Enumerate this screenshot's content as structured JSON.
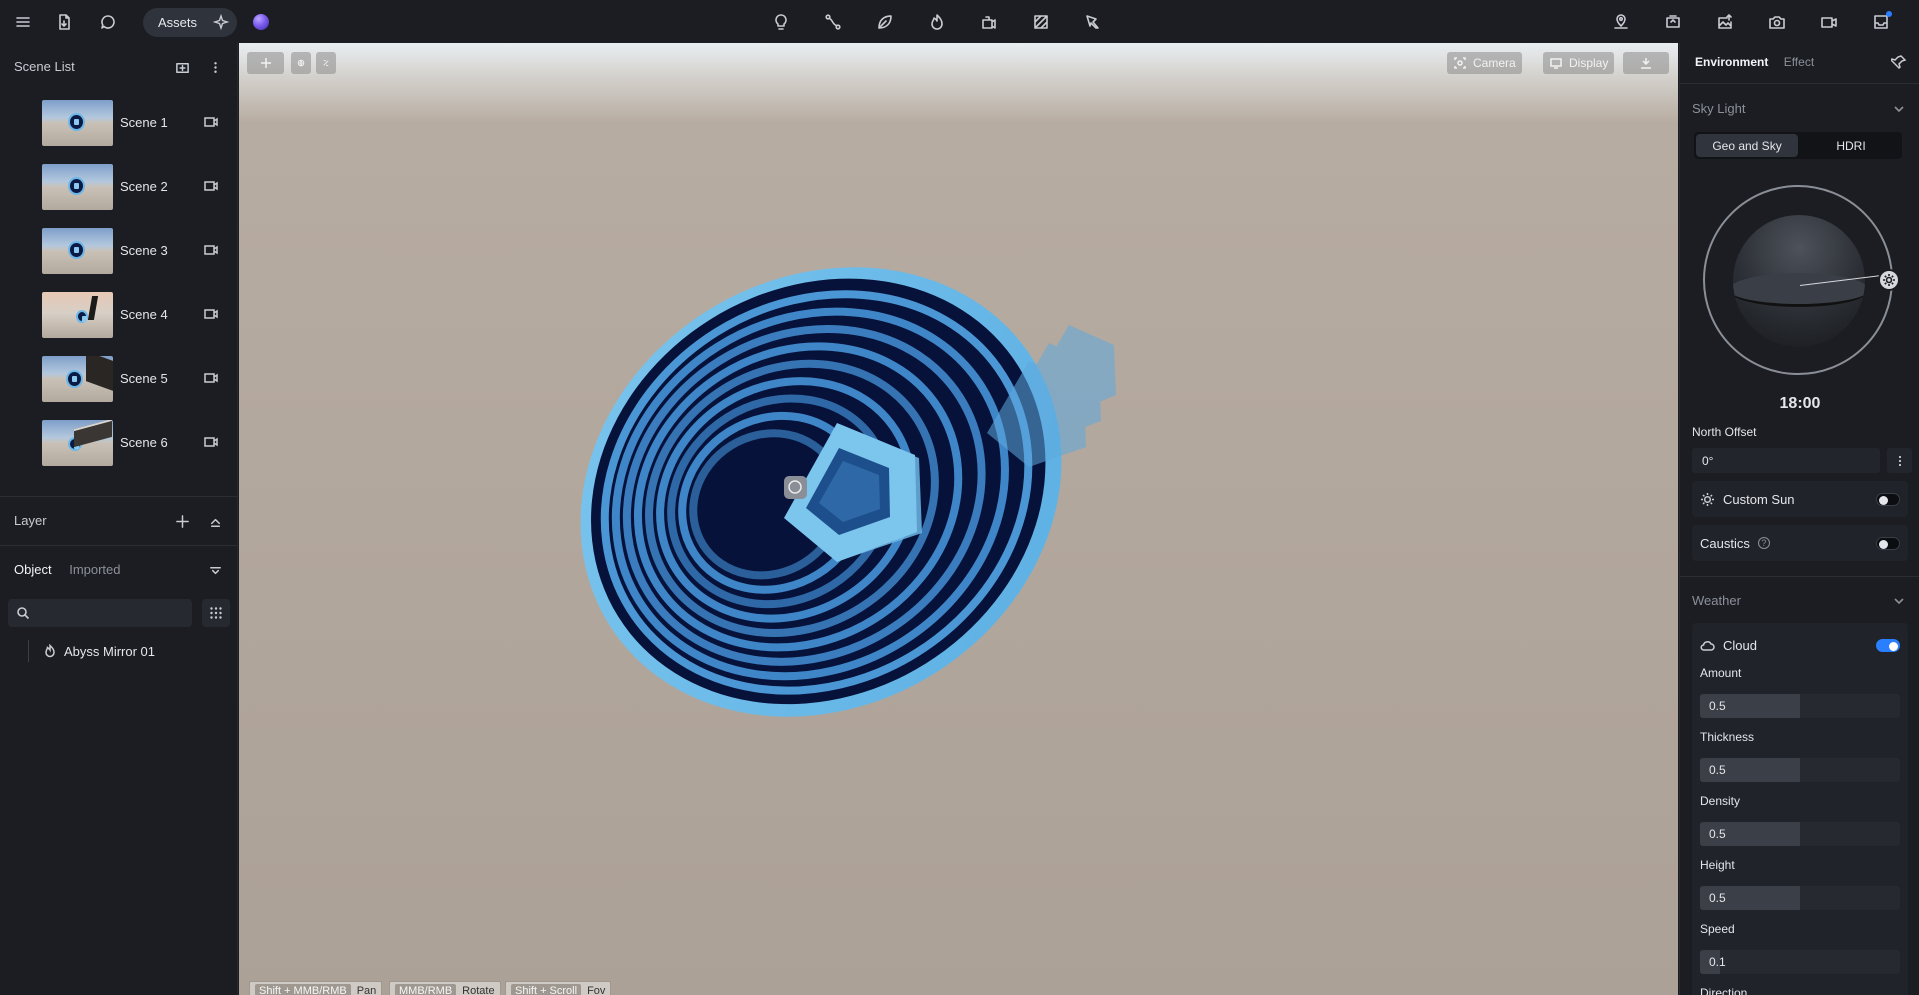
{
  "topbar": {
    "assets_label": "Assets",
    "left_icons": [
      "menu-icon",
      "file-import-icon",
      "chat-icon"
    ],
    "center_icons": [
      "light-bulb-icon",
      "path-icon",
      "leaf-icon",
      "flame-icon",
      "rig-icon",
      "texture-icon",
      "pen-icon"
    ],
    "right_icons": [
      "location-icon",
      "media-icon",
      "image-upload-icon",
      "camera-icon",
      "video-icon",
      "inbox-icon"
    ]
  },
  "scene_list": {
    "title": "Scene List",
    "scenes": [
      {
        "label": "Scene 1"
      },
      {
        "label": "Scene 2"
      },
      {
        "label": "Scene 3"
      },
      {
        "label": "Scene 4"
      },
      {
        "label": "Scene 5"
      },
      {
        "label": "Scene 6"
      }
    ]
  },
  "layer": {
    "title": "Layer",
    "tabs": [
      "Object",
      "Imported"
    ],
    "search_placeholder": "",
    "items": [
      {
        "label": "Abyss Mirror 01"
      }
    ]
  },
  "viewport": {
    "camera_label": "Camera",
    "display_label": "Display",
    "hints": [
      {
        "keys": "Shift + MMB/RMB",
        "action": "Pan"
      },
      {
        "keys": "MMB/RMB",
        "action": "Rotate"
      },
      {
        "keys": "Shift + Scroll",
        "action": "Fov"
      }
    ]
  },
  "right_panel": {
    "tabs": {
      "environment": "Environment",
      "effect": "Effect"
    },
    "sky_light": {
      "title": "Sky Light",
      "mode_options": [
        "Geo and Sky",
        "HDRI"
      ],
      "selected_mode": "Geo and Sky",
      "time": "18:00",
      "north_offset_label": "North Offset",
      "north_offset_value": "0°",
      "custom_sun_label": "Custom Sun",
      "custom_sun_enabled": false,
      "caustics_label": "Caustics",
      "caustics_enabled": false
    },
    "weather": {
      "title": "Weather",
      "cloud_label": "Cloud",
      "cloud_enabled": true,
      "params": [
        {
          "label": "Amount",
          "value": "0.5",
          "fill": 0.5
        },
        {
          "label": "Thickness",
          "value": "0.5",
          "fill": 0.5
        },
        {
          "label": "Density",
          "value": "0.5",
          "fill": 0.5
        },
        {
          "label": "Height",
          "value": "0.5",
          "fill": 0.5
        },
        {
          "label": "Speed",
          "value": "0.1",
          "fill": 0.1
        }
      ],
      "next_label": "Direction"
    }
  },
  "colors": {
    "accent": "#2a7fff",
    "portal_rim": "#6cb7e8",
    "portal_deep": "#0a1a44",
    "ground": "#aca197"
  }
}
